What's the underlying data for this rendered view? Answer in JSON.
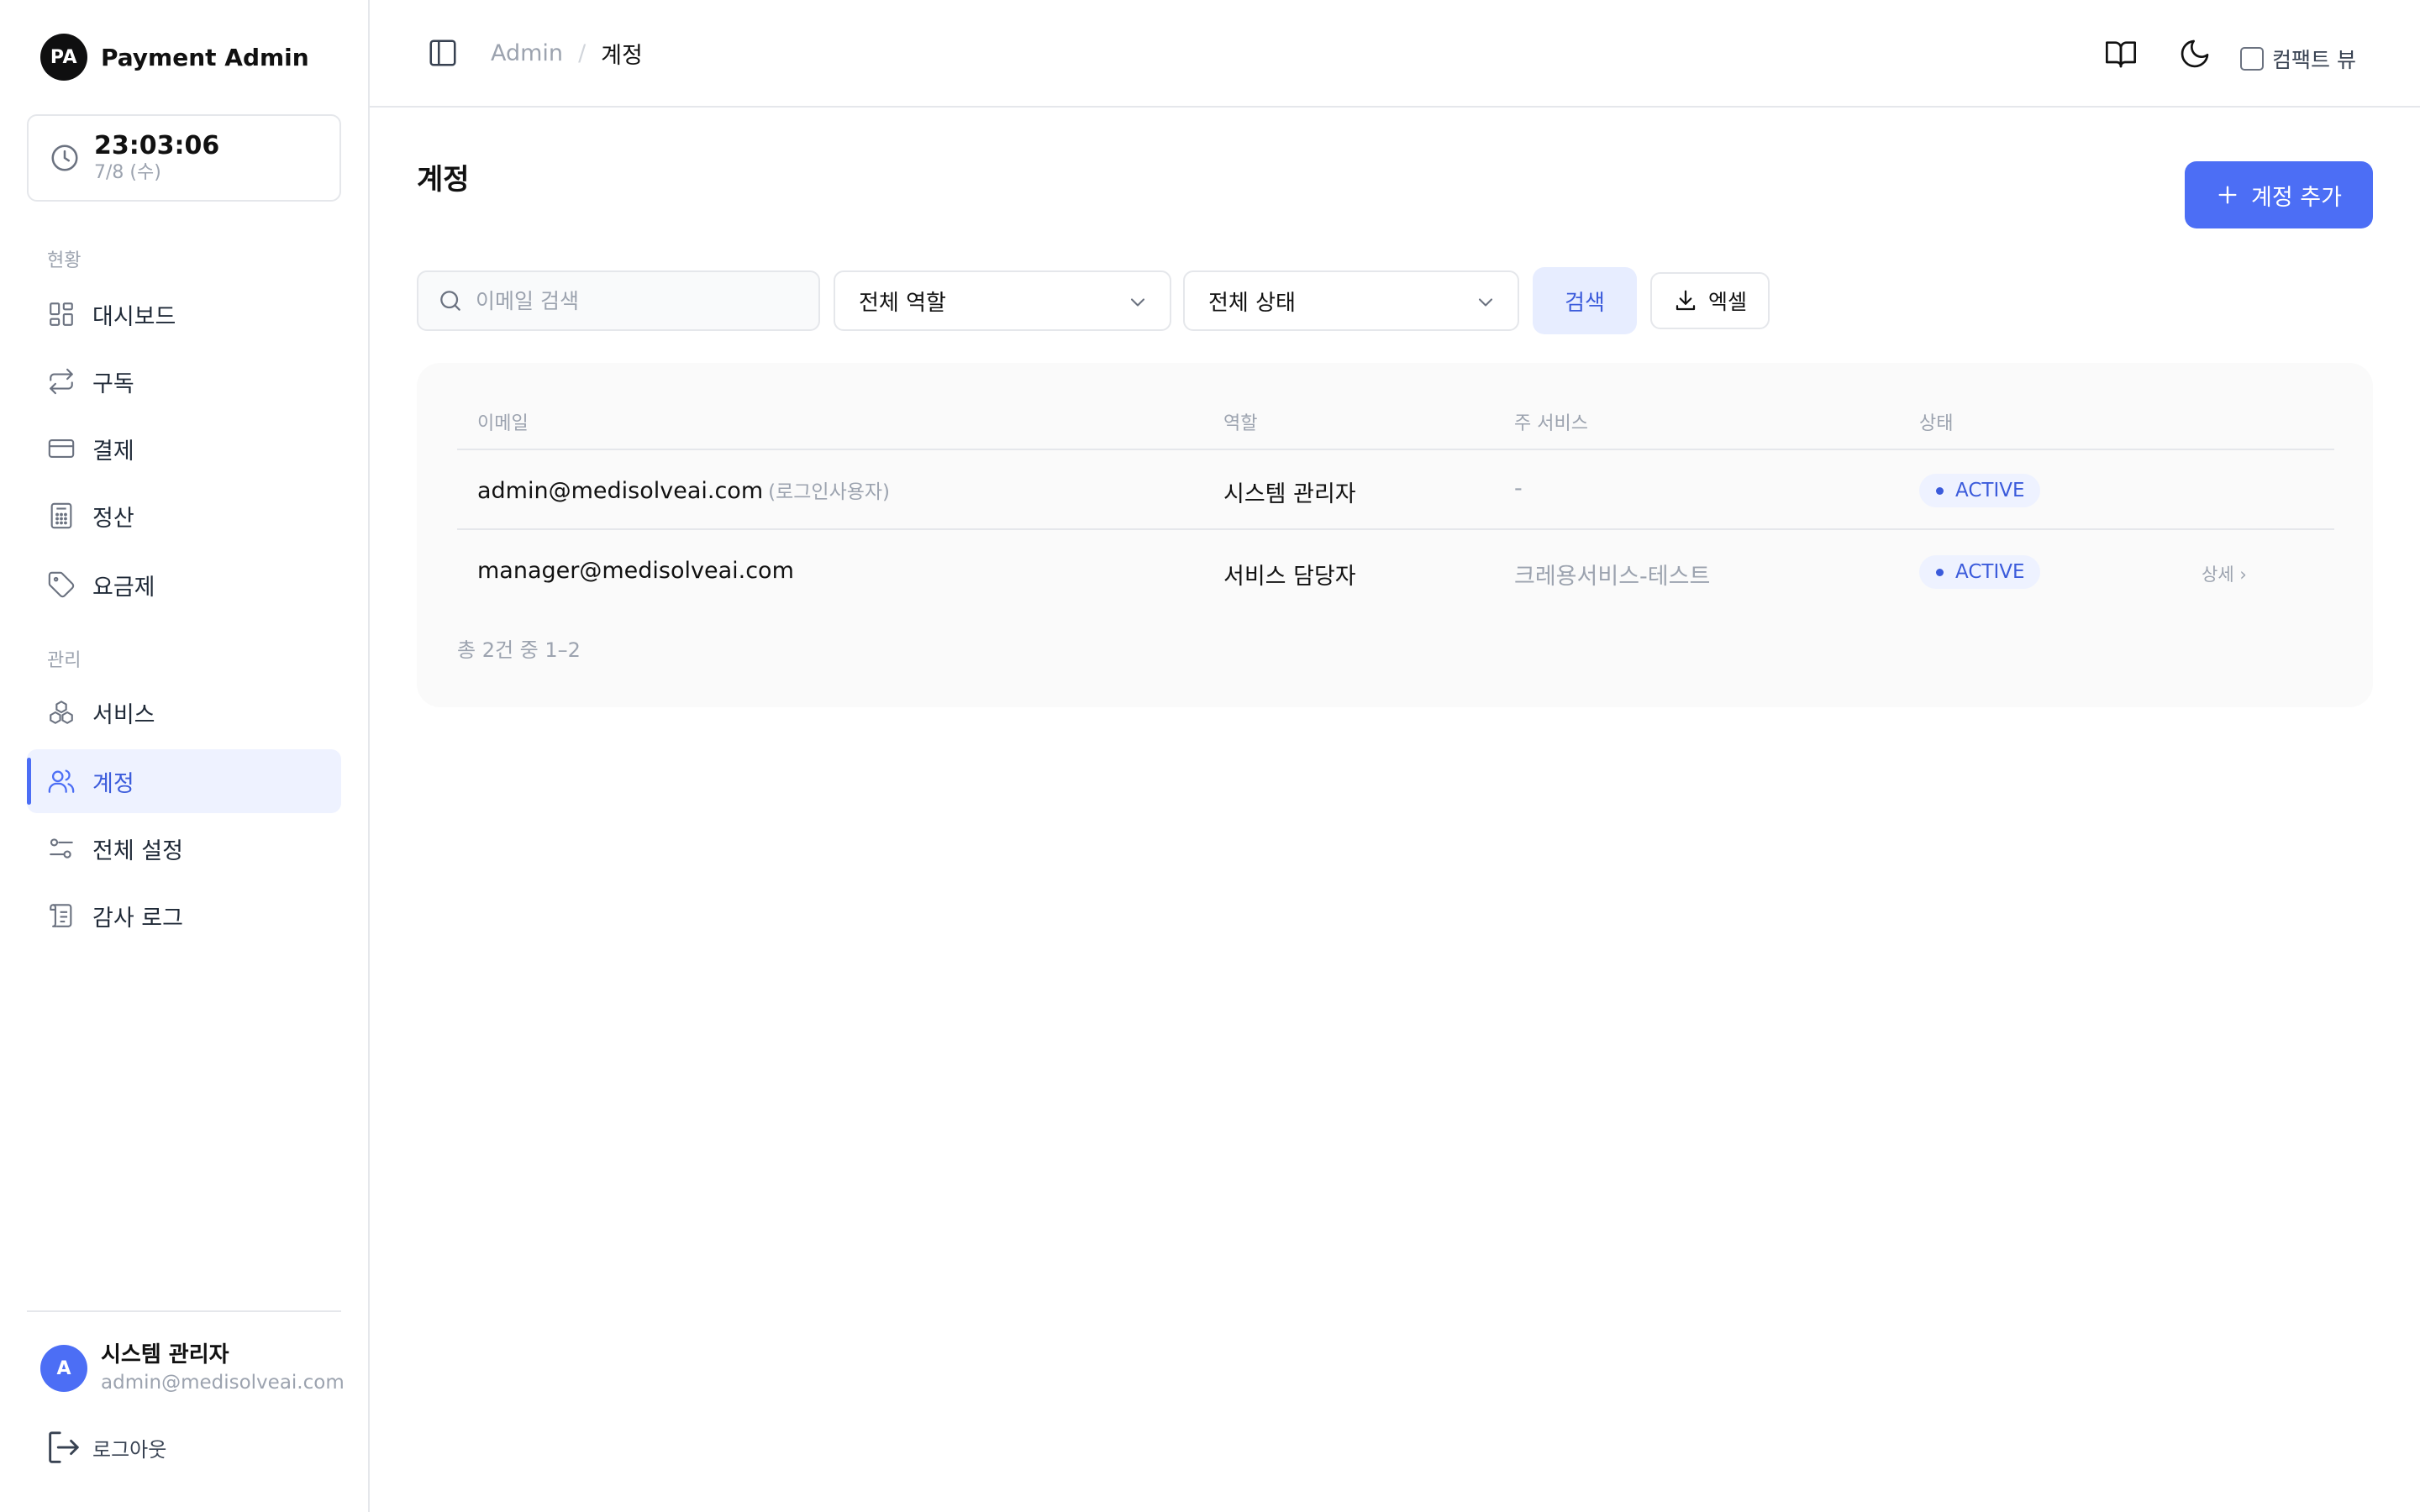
{
  "brand": {
    "logo": "PA",
    "name": "Payment Admin"
  },
  "clock": {
    "time": "23:03:06",
    "date": "7/8 (수)",
    "icon": "clock-icon"
  },
  "nav": {
    "section_status": "현황",
    "section_manage": "관리",
    "items": [
      {
        "label": "대시보드",
        "icon": "dashboard-icon"
      },
      {
        "label": "구독",
        "icon": "repeat-icon"
      },
      {
        "label": "결제",
        "icon": "credit-card-icon"
      },
      {
        "label": "정산",
        "icon": "calculator-icon"
      },
      {
        "label": "요금제",
        "icon": "tag-icon"
      },
      {
        "label": "서비스",
        "icon": "boxes-icon"
      },
      {
        "label": "계정",
        "icon": "users-icon",
        "active": true
      },
      {
        "label": "전체 설정",
        "icon": "settings-sliders-icon"
      },
      {
        "label": "감사 로그",
        "icon": "scroll-icon"
      }
    ]
  },
  "user": {
    "avatar": "A",
    "name": "시스템 관리자",
    "email": "admin@medisolveai.com"
  },
  "logout": {
    "label": "로그아웃"
  },
  "header": {
    "breadcrumb_root": "Admin",
    "breadcrumb_sep": "/",
    "breadcrumb_current": "계정",
    "compact_label": "컴팩트 뷰"
  },
  "page": {
    "title": "계정",
    "add_button": "계정 추가"
  },
  "filters": {
    "search_placeholder": "이메일 검색",
    "role_select": "전체 역할",
    "status_select": "전체 상태",
    "search_button": "검색",
    "excel_button": "엑셀"
  },
  "table": {
    "headers": {
      "email": "이메일",
      "role": "역할",
      "service": "주 서비스",
      "status": "상태"
    },
    "rows": [
      {
        "email": "admin@medisolveai.com",
        "note": "(로그인사용자)",
        "role": "시스템 관리자",
        "service": "-",
        "status": "ACTIVE"
      },
      {
        "email": "manager@medisolveai.com",
        "role": "서비스 담당자",
        "service": "크레용서비스-테스트",
        "status": "ACTIVE",
        "action": "상세 ›"
      }
    ],
    "total": "총 2건 중 1–2"
  },
  "colors": {
    "accent": "#4c6ef5",
    "accent_soft": "#eef2ff",
    "border": "#e5e7eb",
    "muted": "#9ca3af"
  }
}
